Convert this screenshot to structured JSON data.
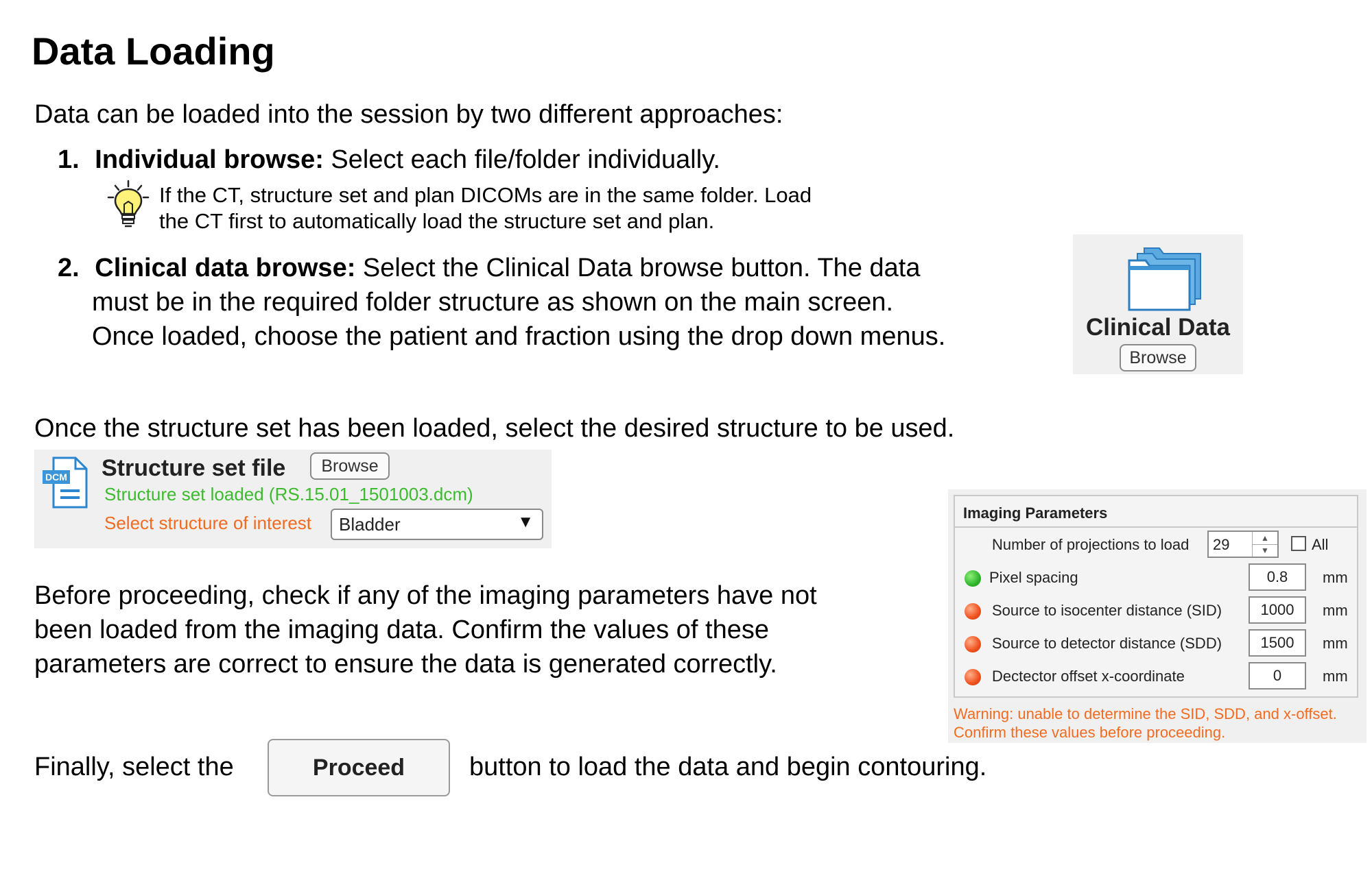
{
  "heading": "Data Loading",
  "intro": "Data can be loaded into the session by two different approaches:",
  "items": [
    {
      "number": "1.",
      "title": "Individual browse:",
      "text": " Select each file/folder individually."
    },
    {
      "number": "2.",
      "title": "Clinical data browse:",
      "text": " Select the Clinical Data browse button. The data",
      "text2": "must be in the required folder structure as shown on the main screen.",
      "text3": "Once loaded, choose the patient and fraction using the drop down menus."
    }
  ],
  "tip": {
    "icon": "lightbulb-icon",
    "line1": "If the CT, structure set and plan DICOMs are in the same folder. Load",
    "line2": "the CT first to automatically load the structure set and plan."
  },
  "clinical_panel": {
    "icon": "folders-icon",
    "label": "Clinical Data",
    "button": "Browse"
  },
  "structure_intro": "Once the structure set has been loaded, select the desired structure to be used.",
  "structure_panel": {
    "icon": "dcm-file-icon",
    "icon_text": "DCM",
    "title": "Structure set file",
    "button": "Browse",
    "status": "Structure set loaded (RS.15.01_1501003.dcm)",
    "select_label": "Select structure of interest",
    "selected": "Bladder",
    "status_color": "#3dbb2e",
    "label_color": "#f26b21"
  },
  "before_text": {
    "line1": "Before proceeding, check if any of the imaging parameters have not",
    "line2": "been loaded from the imaging data. Confirm the values of these",
    "line3": "parameters are correct to ensure the data is generated correctly."
  },
  "imaging_panel": {
    "title": "Imaging Parameters",
    "projections": {
      "label": "Number of projections to load",
      "value": "29",
      "all_label": "All"
    },
    "params": [
      {
        "label": "Pixel spacing",
        "value": "0.8",
        "unit": "mm",
        "status": "green"
      },
      {
        "label": "Source to isocenter distance (SID)",
        "value": "1000",
        "unit": "mm",
        "status": "red"
      },
      {
        "label": "Source to detector distance (SDD)",
        "value": "1500",
        "unit": "mm",
        "status": "red"
      },
      {
        "label": "Dectector offset x-coordinate",
        "value": "0",
        "unit": "mm",
        "status": "red"
      }
    ],
    "warning1": "Warning: unable to determine the SID, SDD, and x-offset.",
    "warning2": "Confirm these values before proceeding."
  },
  "finally": {
    "before": "Finally, select the",
    "button": "Proceed",
    "after": "button to load the data and begin contouring."
  }
}
